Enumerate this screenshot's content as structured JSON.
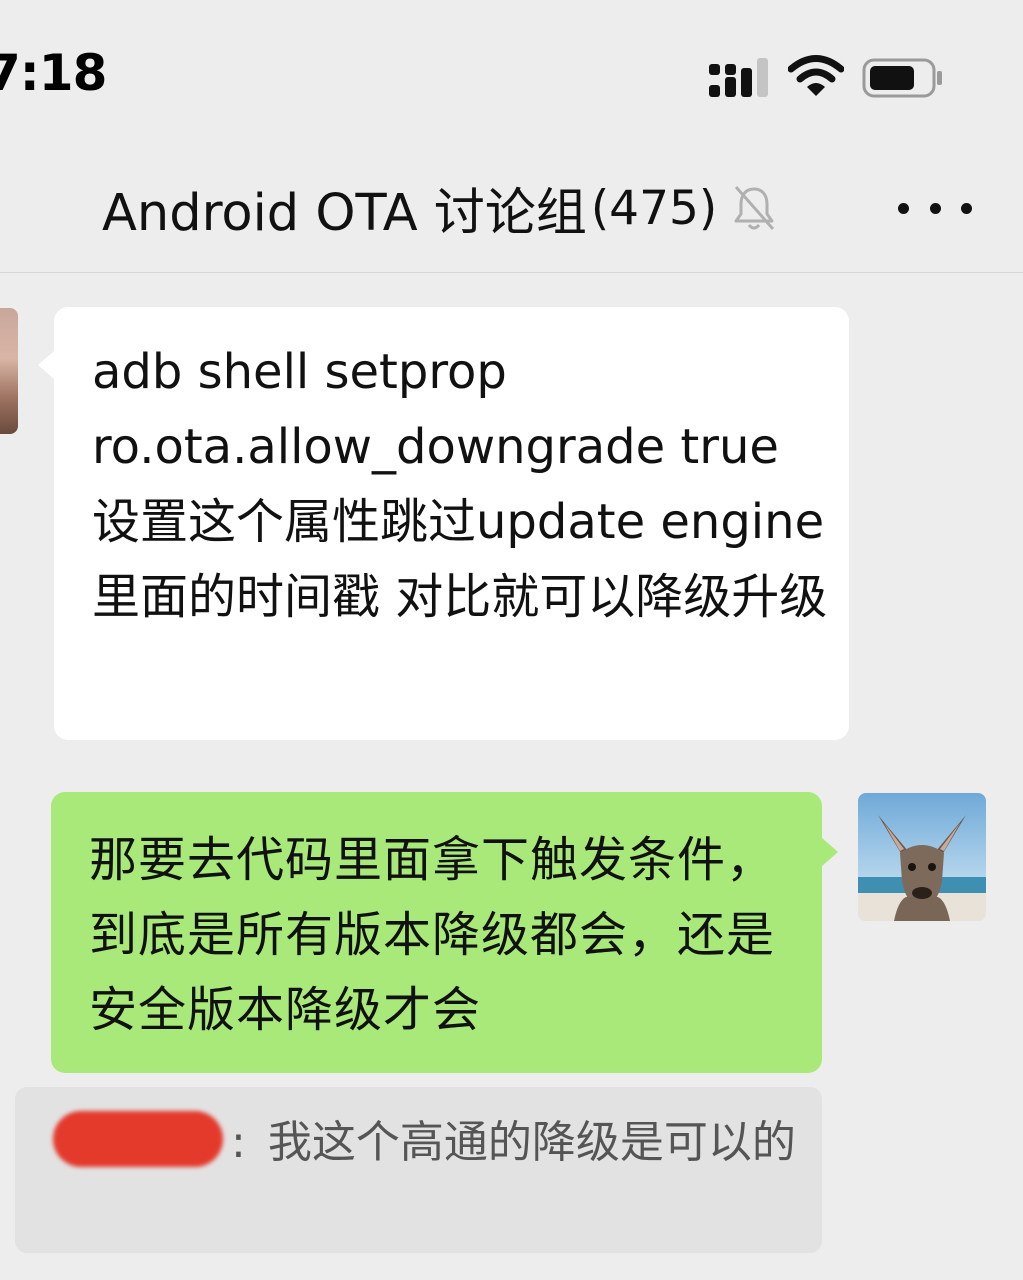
{
  "status_bar": {
    "time": "7:18",
    "icons": [
      "signal-icon",
      "wifi-icon",
      "battery-icon"
    ]
  },
  "header": {
    "title": "Android OTA 讨论组",
    "member_count": "(475)",
    "mute_icon": "bell-slash-icon",
    "more_icon": "more-dots-icon"
  },
  "messages": [
    {
      "side": "left",
      "text": "adb shell setprop ro.ota.allow_downgrade true 设置这个属性跳过update engine 里面的时间戳 对比就可以降级升级"
    },
    {
      "side": "right",
      "text": "那要去代码里面拿下触发条件，到底是所有版本降级都会，还是安全版本降级才会"
    }
  ],
  "quote": {
    "separator": ":",
    "text": "我这个高通的降级是可以的"
  },
  "colors": {
    "background": "#ededed",
    "incoming_bubble": "#ffffff",
    "outgoing_bubble": "#a9e97a",
    "redaction": "#e33a2c"
  }
}
